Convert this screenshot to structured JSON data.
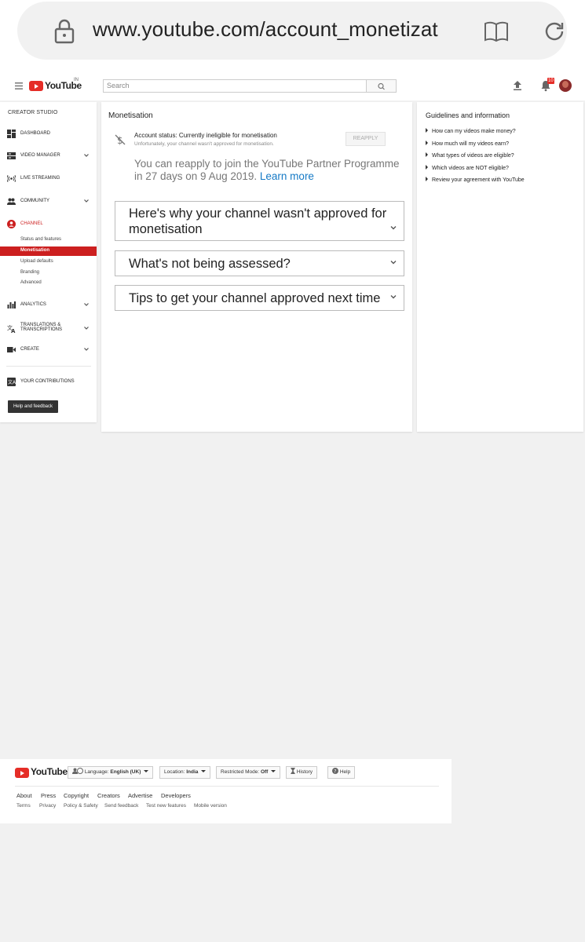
{
  "browser": {
    "url": "www.youtube.com/account_monetizat"
  },
  "header": {
    "logo_text": "YouTube",
    "logo_country": "IN",
    "search_placeholder": "Search",
    "notification_count": "10"
  },
  "sidebar": {
    "title": "CREATOR STUDIO",
    "items": [
      {
        "label": "DASHBOARD",
        "icon": "dashboard-icon"
      },
      {
        "label": "VIDEO MANAGER",
        "icon": "video-manager-icon"
      },
      {
        "label": "LIVE STREAMING",
        "icon": "live-streaming-icon"
      },
      {
        "label": "COMMUNITY",
        "icon": "community-icon"
      },
      {
        "label": "CHANNEL",
        "icon": "channel-icon"
      },
      {
        "label": "ANALYTICS",
        "icon": "analytics-icon"
      },
      {
        "label": "TRANSLATIONS & TRANSCRIPTIONS",
        "icon": "translate-icon"
      },
      {
        "label": "CREATE",
        "icon": "create-icon"
      },
      {
        "label": "YOUR CONTRIBUTIONS",
        "icon": "contributions-icon"
      }
    ],
    "translations_line1": "TRANSLATIONS &",
    "translations_line2": "TRANSCRIPTIONS",
    "channel_sub": [
      "Status and features",
      "Monetisation",
      "Upload defaults",
      "Branding",
      "Advanced"
    ],
    "help_button": "Help and feedback",
    "accent_color": "#cc1f1f"
  },
  "main": {
    "title": "Monetisation",
    "status_title": "Account status: Currently ineligible for monetisation",
    "status_subtitle": "Unfortunately, your channel wasn't approved for monetisation.",
    "reapply_button": "REAPPLY",
    "reapply_text": "You can reapply to join the YouTube Partner Programme in 27 days on 9 Aug 2019.",
    "learn_more": "Learn more",
    "accordions": [
      {
        "line1": "Here's why your channel wasn't approved for",
        "line2": "monetisation"
      },
      {
        "line1": "What's not being assessed?"
      },
      {
        "line1": "Tips to get your channel approved next time"
      }
    ]
  },
  "guidelines": {
    "title": "Guidelines and information",
    "links": [
      "How can my videos make money?",
      "How much will my videos earn?",
      "What types of videos are eligible?",
      "Which videos are NOT eligible?",
      "Review your agreement with YouTube"
    ]
  },
  "footer": {
    "logo_text": "YouTube",
    "language_label": "Language:",
    "language_value": "English (UK)",
    "location_label": "Location:",
    "location_value": "India",
    "restricted_label": "Restricted Mode:",
    "restricted_value": "Off",
    "history": "History",
    "help": "Help",
    "links_primary": [
      "About",
      "Press",
      "Copyright",
      "Creators",
      "Advertise",
      "Developers"
    ],
    "links_secondary": [
      "Terms",
      "Privacy",
      "Policy & Safety",
      "Send feedback",
      "Test new features",
      "Mobile version"
    ]
  }
}
